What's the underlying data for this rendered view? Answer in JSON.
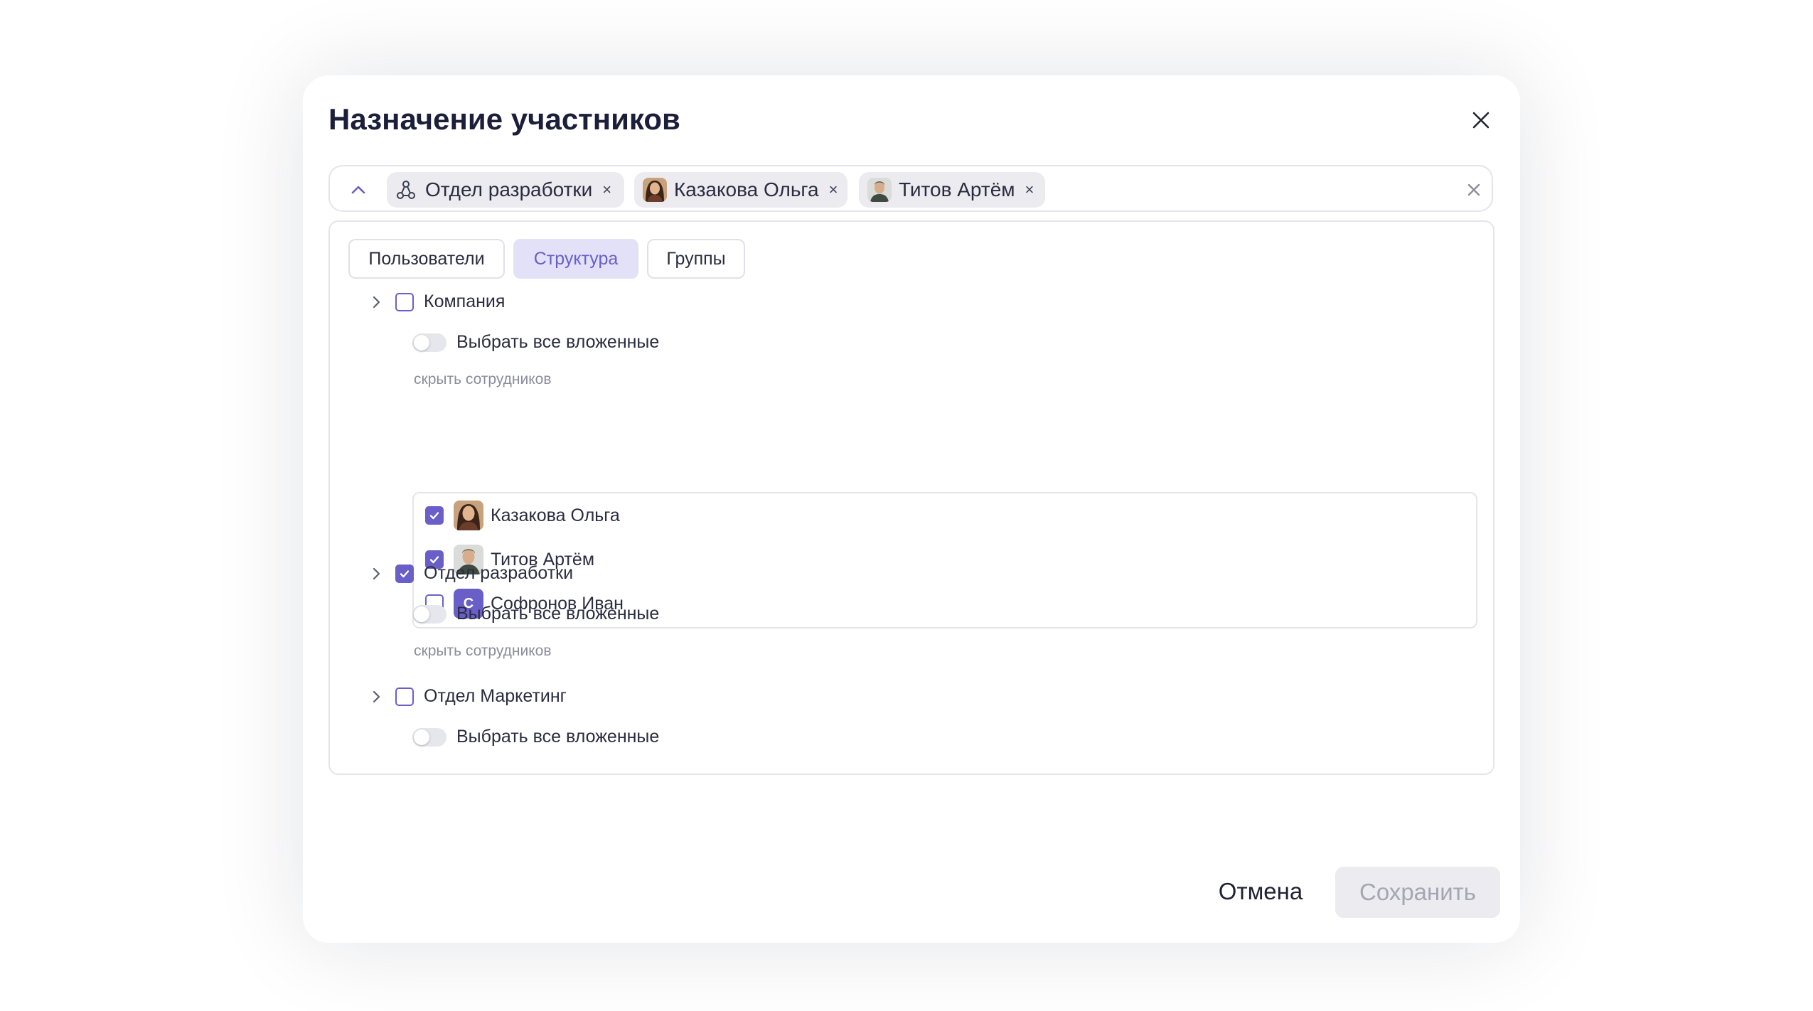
{
  "dialog": {
    "title": "Назначение участников",
    "close_icon": "close-icon"
  },
  "selection": {
    "chips": [
      {
        "label": "Отдел разработки",
        "icon": "structure-icon"
      },
      {
        "label": "Казакова Ольга",
        "icon": "avatar-photo"
      },
      {
        "label": "Титов Артём",
        "icon": "avatar-photo"
      }
    ],
    "chip_remove": "×"
  },
  "tabs": [
    {
      "label": "Пользователи",
      "active": false
    },
    {
      "label": "Структура",
      "active": true
    },
    {
      "label": "Группы",
      "active": false
    }
  ],
  "tree": [
    {
      "label": "Компания",
      "checked": false,
      "toggle_label": "Выбрать все вложенные",
      "toggle_on": false,
      "hide_link": "скрыть сотрудников",
      "employees": [
        {
          "name": "Казакова Ольга",
          "checked": true,
          "avatar": "photo"
        },
        {
          "name": "Титов Артём",
          "checked": true,
          "avatar": "photo"
        },
        {
          "name": "Софронов Иван",
          "checked": false,
          "avatar": "letter",
          "letter": "С"
        }
      ]
    },
    {
      "label": "Отдел разработки",
      "checked": true,
      "toggle_label": "Выбрать все вложенные",
      "toggle_on": false,
      "hide_link": "скрыть сотрудников"
    },
    {
      "label": "Отдел Маркетинг",
      "checked": false,
      "toggle_label": "Выбрать все вложенные",
      "toggle_on": false
    }
  ],
  "footer": {
    "cancel_label": "Отмена",
    "save_label": "Сохранить"
  },
  "colors": {
    "accent": "#6a5fc8",
    "active_tab_bg": "#e2e1f7",
    "chip_bg": "#ebebf0",
    "disabled_text": "#a4a6b3"
  }
}
